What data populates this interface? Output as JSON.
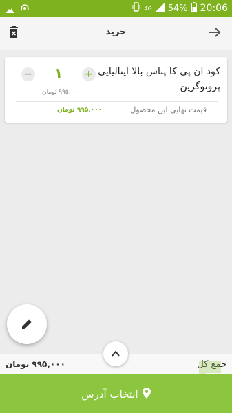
{
  "status_bar": {
    "time": "20:06",
    "battery": "54%",
    "network": "4G"
  },
  "toolbar": {
    "title": "خرید"
  },
  "cart_items": [
    {
      "name": "کود ان پی کا پتاس بالا ایتالیایی پروتوگرین",
      "quantity": "۱",
      "minus": "−",
      "plus": "+",
      "unit_price": "۹۹۵,۰۰۰ تومان",
      "final_price_label": "قیمت نهایی این محصول:",
      "final_price": "۹۹۵,۰۰۰ تومان"
    }
  ],
  "summary": {
    "total_label": "جمع کل",
    "total_value": "۹۹۵,۰۰۰ تومان"
  },
  "address_button": {
    "label": "انتخاب آدرس"
  },
  "colors": {
    "accent": "#7fb21f",
    "button_green": "#8cc63f"
  }
}
